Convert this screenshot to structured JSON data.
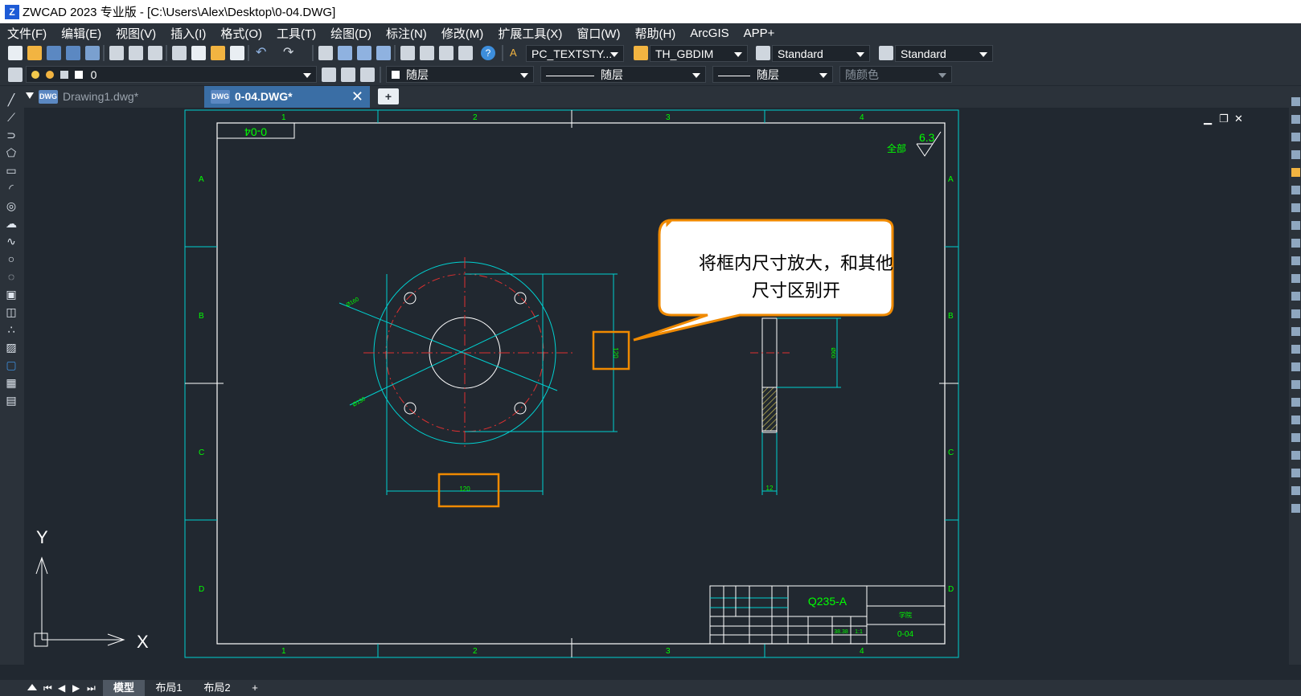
{
  "app": {
    "title": "ZWCAD 2023 专业版 - [C:\\Users\\Alex\\Desktop\\0-04.DWG]"
  },
  "menu": [
    "文件(F)",
    "编辑(E)",
    "视图(V)",
    "插入(I)",
    "格式(O)",
    "工具(T)",
    "绘图(D)",
    "标注(N)",
    "修改(M)",
    "扩展工具(X)",
    "窗口(W)",
    "帮助(H)",
    "ArcGIS",
    "APP+"
  ],
  "toolbar": {
    "text_style": "PC_TEXTSTY...",
    "dim_style": "TH_GBDIM",
    "table_style": "Standard",
    "multileader_style": "Standard",
    "layer": "0",
    "color": "随层",
    "linetype": "随层",
    "lineweight": "随层",
    "plotstyle": "随颜色"
  },
  "tabs": [
    {
      "label": "Drawing1.dwg*",
      "active": false
    },
    {
      "label": "0-04.DWG*",
      "active": true
    }
  ],
  "layout_tabs": [
    "模型",
    "布局1",
    "布局2",
    "+"
  ],
  "drawing": {
    "border_cols": [
      "1",
      "2",
      "3",
      "4"
    ],
    "border_rows": [
      "A",
      "B",
      "C",
      "D"
    ],
    "title_corner": "0-04",
    "roughness_label": "全部",
    "roughness_value": "6.3",
    "material": "Q235-A",
    "drawing_no": "0-04",
    "dims": {
      "horizontal": "120",
      "vertical": "120",
      "diam_outer": "Ø160",
      "diam_bolt": "Ø130",
      "thickness": "12",
      "side_height": "Ø60"
    },
    "title_block": {
      "scale": "1:1",
      "sheet": "38.38",
      "unit": "学院"
    }
  },
  "callout": {
    "text": "将框内尺寸放大，和其他尺寸区别开"
  },
  "ucs": {
    "x": "X",
    "y": "Y"
  },
  "colors": {
    "border_cyan": "#00d0d0",
    "text_green": "#00ff00",
    "center_red": "#e03030",
    "highlight_orange": "#f08a00",
    "callout_border": "#f08a00",
    "background": "#212830"
  }
}
